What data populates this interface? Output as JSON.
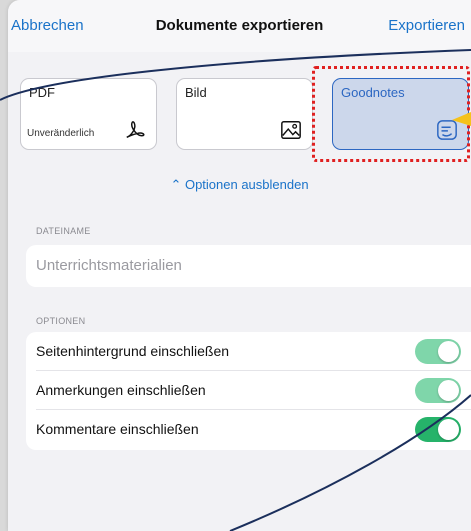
{
  "navbar": {
    "cancel_label": "Abbrechen",
    "title": "Dokumente exportieren",
    "export_label": "Exportieren"
  },
  "formats": [
    {
      "label": "PDF",
      "sublabel": "Unveränderlich",
      "icon": "pdf-icon",
      "selected": false
    },
    {
      "label": "Bild",
      "sublabel": "",
      "icon": "image-icon",
      "selected": false
    },
    {
      "label": "Goodnotes",
      "sublabel": "",
      "icon": "goodnotes-icon",
      "selected": true
    }
  ],
  "options_toggle": {
    "label": "Optionen ausblenden",
    "icon": "chevron-up-icon"
  },
  "filename": {
    "section_label": "DATEINAME",
    "placeholder": "Unterrichtsmaterialien"
  },
  "options": {
    "section_label": "OPTIONEN",
    "items": [
      {
        "label": "Seitenhintergrund einschließen",
        "on": true,
        "color": "#7fd6aa"
      },
      {
        "label": "Anmerkungen einschließen",
        "on": true,
        "color": "#7fd6aa"
      },
      {
        "label": "Kommentare einschließen",
        "on": true,
        "color": "#26b36a"
      }
    ]
  },
  "colors": {
    "accent": "#1a73c9",
    "selection": "#2c67c2",
    "highlight": "#e02020",
    "annotation_arrow": "#f5c21b"
  }
}
